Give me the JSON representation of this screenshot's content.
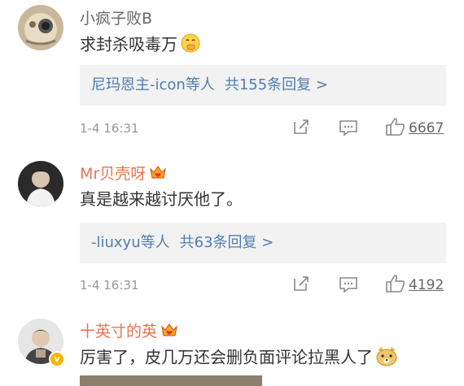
{
  "comments": [
    {
      "username": "小疯子败B",
      "text": "求封杀吸毒万",
      "reply_users": "尼玛恩主-icon等人",
      "reply_total": "共155条回复 >",
      "time": "1-4 16:31",
      "likes": "6667"
    },
    {
      "username": "Mr贝壳呀",
      "text": "真是越来越讨厌他了。",
      "reply_users": "-liuxyu等人",
      "reply_total": "共63条回复 >",
      "time": "1-4 16:31",
      "likes": "4192"
    },
    {
      "username": "十英寸的英",
      "text": "厉害了，皮几万还会删负面评论拉黑人了",
      "verified": true
    }
  ],
  "colors": {
    "link": "#507daf",
    "username_vip": "#eb7350",
    "username_normal": "#666666",
    "meta": "#999999",
    "reply_bg": "#f2f2f2"
  },
  "icons": [
    "share-icon",
    "comment-icon",
    "like-icon",
    "crown-badge-icon",
    "verified-badge-icon",
    "emoji-icon"
  ]
}
